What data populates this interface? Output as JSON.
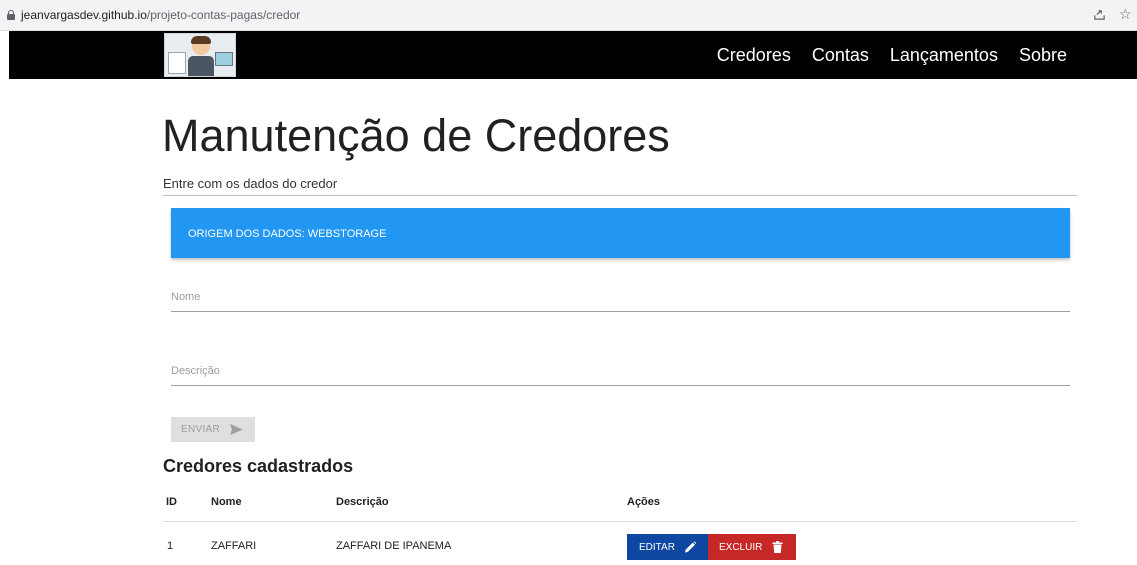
{
  "browser": {
    "url_host": "jeanvargasdev.github.io",
    "url_path": "/projeto-contas-pagas/credor"
  },
  "nav": {
    "links": [
      "Credores",
      "Contas",
      "Lançamentos",
      "Sobre"
    ]
  },
  "page": {
    "title": "Manutenção de Credores",
    "subtitle": "Entre com os dados do credor"
  },
  "banner": {
    "text": "ORIGEM DOS DADOS: WEBSTORAGE",
    "color": "#2196f3"
  },
  "form": {
    "nome_placeholder": "Nome",
    "nome_value": "",
    "descricao_placeholder": "Descrição",
    "descricao_value": "",
    "submit_label": "ENVIAR",
    "submit_icon": "send-icon"
  },
  "table": {
    "title": "Credores cadastrados",
    "headers": [
      "ID",
      "Nome",
      "Descrição",
      "Ações"
    ],
    "rows": [
      {
        "id": "1",
        "nome": "ZAFFARI",
        "descricao": "ZAFFARI DE IPANEMA",
        "edit_label": "EDITAR",
        "delete_label": "EXCLUIR"
      }
    ]
  },
  "colors": {
    "nav_bg": "#000000",
    "edit_button": "#0d47a1",
    "delete_button": "#c62828"
  }
}
